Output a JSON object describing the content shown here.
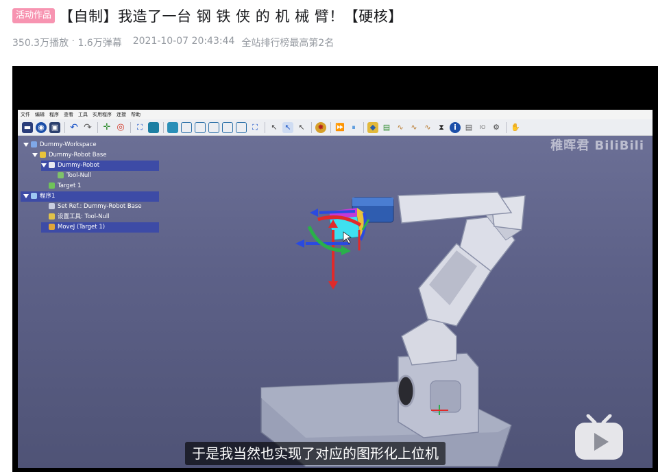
{
  "header": {
    "badge": "活动作品",
    "title": "【自制】我造了一台 钢 铁 侠 的 机 械 臂！【硬核】"
  },
  "meta": {
    "plays": "350.3万播放",
    "separator": " · ",
    "danmaku": "1.6万弹幕",
    "date": "2021-10-07 20:43:44",
    "rank": "全站排行榜最高第2名"
  },
  "video": {
    "subtitle": "于是我当然也实现了对应的图形化上位机",
    "watermark": "稚晖君 BiliBili",
    "app": {
      "menu": [
        "文件",
        "编辑",
        "程序",
        "查看",
        "工具",
        "实用程序",
        "连接",
        "帮助"
      ],
      "tree": [
        {
          "label": "Dummy-Workspace",
          "depth": 0,
          "caret": true,
          "selected": false,
          "icon": "workspace-icon"
        },
        {
          "label": "Dummy-Robot Base",
          "depth": 1,
          "caret": true,
          "selected": false,
          "icon": "robot-base-icon"
        },
        {
          "label": "Dummy-Robot",
          "depth": 2,
          "caret": true,
          "selected": true,
          "icon": "robot-icon"
        },
        {
          "label": "Tool-Null",
          "depth": 3,
          "caret": false,
          "selected": false,
          "icon": "tool-icon"
        },
        {
          "label": "Target 1",
          "depth": 2,
          "caret": false,
          "selected": false,
          "icon": "target-icon"
        },
        {
          "label": "程序1",
          "depth": 0,
          "caret": true,
          "selected": true,
          "icon": "program-icon"
        },
        {
          "label": "Set Ref.: Dummy-Robot Base",
          "depth": 2,
          "caret": false,
          "selected": false,
          "icon": "set-ref-icon"
        },
        {
          "label": "设置工具: Tool-Null",
          "depth": 2,
          "caret": false,
          "selected": false,
          "icon": "set-tool-icon"
        },
        {
          "label": "MoveJ (Target 1)",
          "depth": 2,
          "caret": false,
          "selected": true,
          "icon": "movej-icon"
        }
      ]
    }
  },
  "colors": {
    "badge": "#f794b1",
    "meta": "#9499a0",
    "scene_top": "#6e7298",
    "tree_selected": "#3d4ba6"
  }
}
